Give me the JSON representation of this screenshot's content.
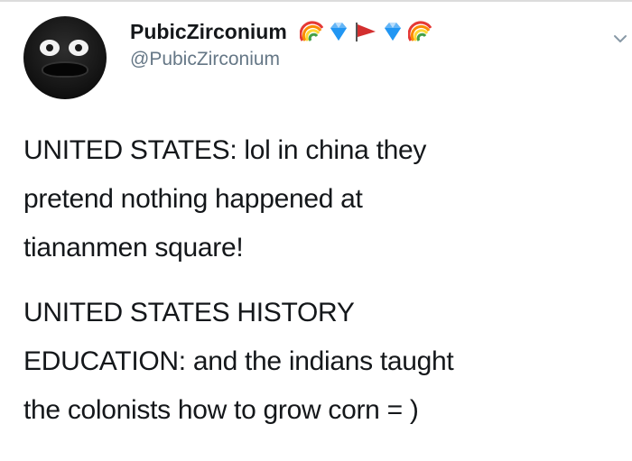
{
  "tweet": {
    "author": {
      "display_name": "PubicZirconium",
      "handle": "@PubicZirconium",
      "name_emojis": [
        "rainbow-icon",
        "gem-icon",
        "triangular-flag-icon",
        "gem-icon",
        "rainbow-icon"
      ]
    },
    "paragraphs": [
      "UNITED STATES: lol in china they\npretend nothing happened at\ntiananmen square!",
      "UNITED STATES HISTORY\nEDUCATION: and the indians taught\nthe colonists how to grow corn  = )"
    ],
    "menu_icon": "chevron-down-icon"
  },
  "colors": {
    "text": "#14171a",
    "secondary": "#657786",
    "background": "#ffffff"
  }
}
